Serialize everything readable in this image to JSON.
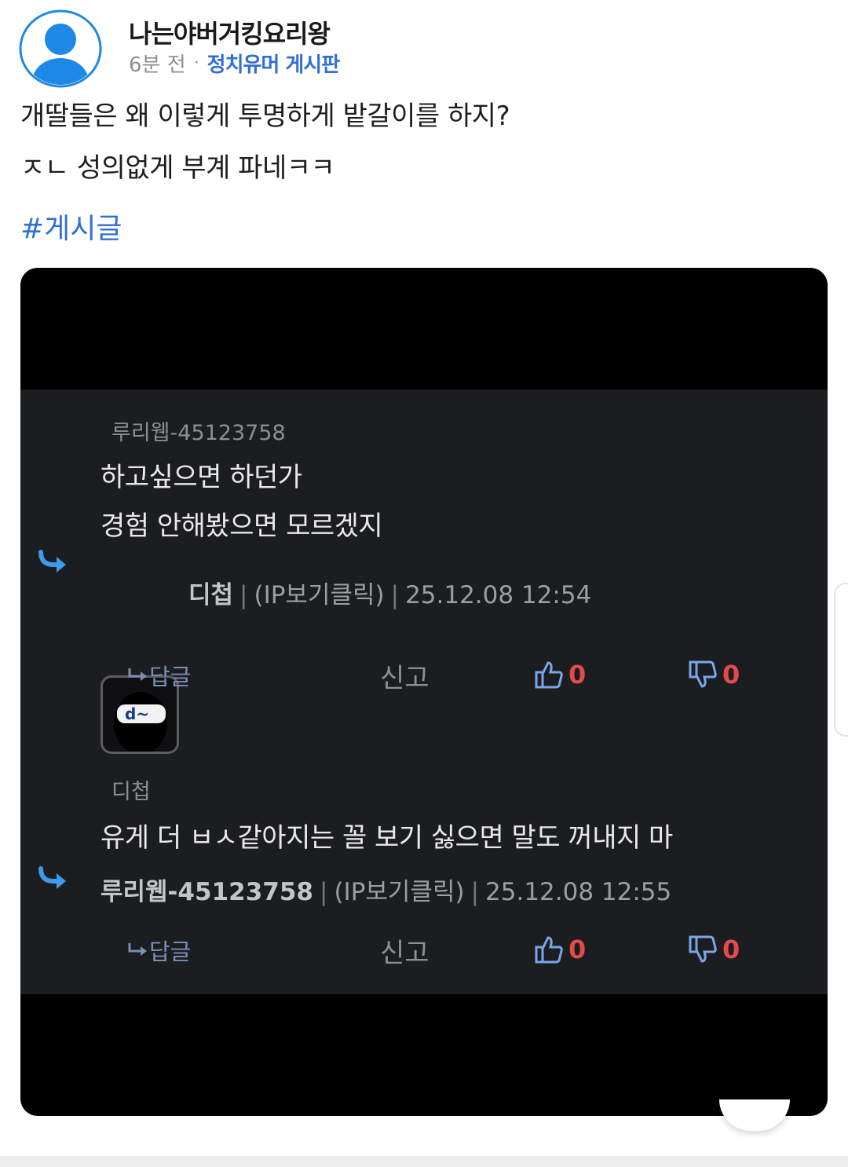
{
  "post": {
    "author": "나는야버거킹요리왕",
    "time_ago": "6분 전",
    "separator": "·",
    "board": "정치유머 게시판",
    "body_line1": "개딸들은 왜 이렇게 투명하게 밭갈이를 하지?",
    "body_line2": "ㅈㄴ 성의없게 부계 파네ㅋㅋ",
    "hashtag": "#게시글"
  },
  "screenshot": {
    "comment1": {
      "author": "루리웹-45123758",
      "line1": "하고싶으면 하던가",
      "line2": "경험 안해봤으면 모르겠지",
      "reply_nick": "디첩",
      "ip": "(IP보기클릭)",
      "timestamp": "25.12.08 12:54",
      "badge_text": "d~"
    },
    "actions1": {
      "reply": "답글",
      "report": "신고",
      "up": "0",
      "down": "0"
    },
    "comment2": {
      "author": "디첩",
      "line1": "유게 더 ㅂㅅ같아지는 꼴 보기 싫으면 말도 꺼내지 마",
      "reply_nick": "루리웹-45123758",
      "ip": "(IP보기클릭)",
      "timestamp": "25.12.08 12:55"
    },
    "actions2": {
      "reply": "답글",
      "report": "신고",
      "up": "0",
      "down": "0"
    },
    "info_separator": "|"
  },
  "colors": {
    "accent_blue": "#2f6fd6",
    "avatar_blue": "#1e88e5",
    "vote_red": "#e24b4b",
    "dark_panel": "#1c1d20"
  }
}
